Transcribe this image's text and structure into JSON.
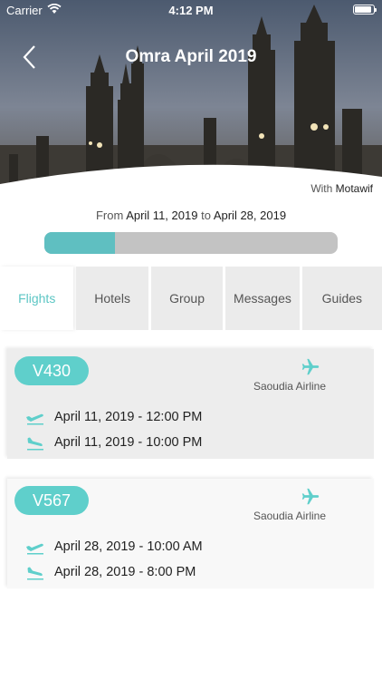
{
  "status_bar": {
    "carrier": "Carrier",
    "time": "4:12 PM"
  },
  "header": {
    "title": "Omra April 2019",
    "with_prefix": "With",
    "with_name": "Motawif"
  },
  "trip": {
    "from_label": "From",
    "start_date": "April 11, 2019",
    "to_label": "to",
    "end_date": "April 28, 2019",
    "progress": 0.24
  },
  "tabs": [
    {
      "label": "Flights",
      "active": true
    },
    {
      "label": "Hotels",
      "active": false
    },
    {
      "label": "Group",
      "active": false
    },
    {
      "label": "Messages",
      "active": false
    },
    {
      "label": "Guides",
      "active": false
    }
  ],
  "flights": [
    {
      "code": "V430",
      "airline": "Saoudia Airline",
      "departure": "April 11, 2019 - 12:00 PM",
      "arrival": "April 11, 2019 - 10:00 PM"
    },
    {
      "code": "V567",
      "airline": "Saoudia Airline",
      "departure": "April 28, 2019 - 10:00 AM",
      "arrival": "April 28, 2019 - 8:00 PM"
    }
  ],
  "colors": {
    "accent": "#5fcfcb",
    "progress_track": "#c3c3c3",
    "tab_inactive": "#ebebeb"
  }
}
